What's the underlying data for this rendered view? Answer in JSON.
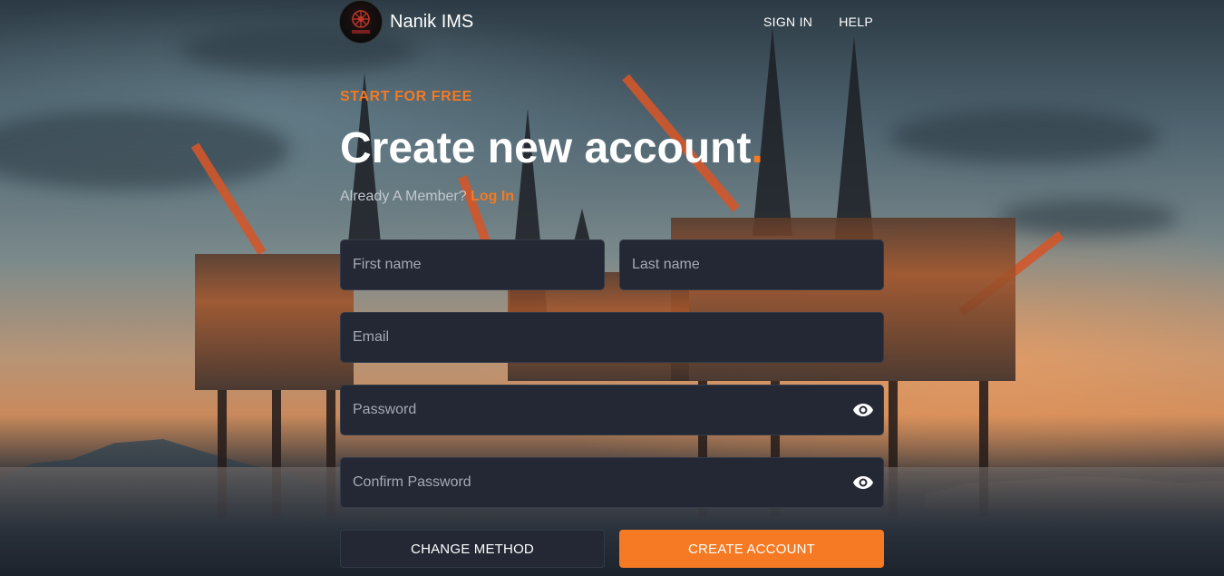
{
  "app": {
    "name": "Nanik IMS",
    "logo_text": "NANIK"
  },
  "nav": {
    "sign_in": "SIGN IN",
    "help": "HELP"
  },
  "hero": {
    "eyebrow": "START FOR FREE",
    "title": "Create new account",
    "title_dot": ".",
    "member_prompt": "Already A Member?",
    "login_link": "Log In"
  },
  "form": {
    "first_name": {
      "placeholder": "First name",
      "value": ""
    },
    "last_name": {
      "placeholder": "Last name",
      "value": ""
    },
    "email": {
      "placeholder": "Email",
      "value": ""
    },
    "password": {
      "placeholder": "Password",
      "value": ""
    },
    "confirm_password": {
      "placeholder": "Confirm Password",
      "value": ""
    },
    "change_method_label": "CHANGE METHOD",
    "create_account_label": "CREATE ACCOUNT"
  },
  "icons": {
    "password_visibility": "eye-icon",
    "confirm_password_visibility": "eye-icon"
  },
  "colors": {
    "accent": "#f57a23",
    "field_bg": "#232834",
    "text": "#ffffff",
    "muted_text": "#c2c7cd"
  }
}
